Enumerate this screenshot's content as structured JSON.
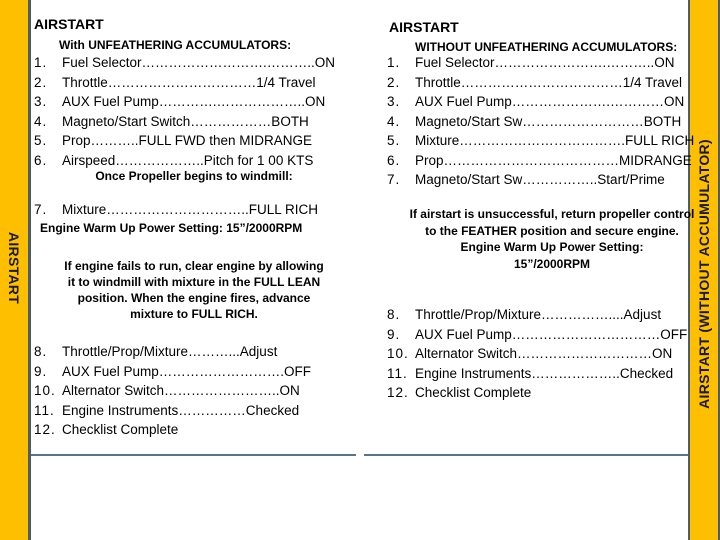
{
  "side_tabs": {
    "left": "AIRSTART",
    "right": "AIRSTART (WITHOUT ACCUMULATOR)"
  },
  "colors": {
    "tab_yellow": "#fdbf00",
    "border_slate": "#4a5e70",
    "rule": "#5b7387"
  },
  "left_panel": {
    "title": "AIRSTART",
    "subtitle": "With UNFEATHERING ACCUMULATORS:",
    "steps_part1": [
      {
        "num": "1.",
        "text": "Fuel Selector……………………….………..ON"
      },
      {
        "num": "2.",
        "text": "Throttle……………………………1/4 Travel"
      },
      {
        "num": "3.",
        "text": "AUX Fuel Pump………….………………..ON"
      },
      {
        "num": "4.",
        "text": "Magneto/Start Switch………………BOTH"
      },
      {
        "num": "5.",
        "text": "Prop………..FULL FWD then MIDRANGE"
      },
      {
        "num": "6.",
        "text": "Airspeed………………..Pitch for 1 00 KTS"
      }
    ],
    "windmill_note": "Once Propeller begins to windmill:",
    "step7": {
      "num": "7.",
      "text": "Mixture…………………………..FULL RICH"
    },
    "warmup_note": "Engine Warm Up Power Setting: 15”/2000RPM",
    "fail_note": "If engine fails to run, clear engine by allowing it to windmill with mixture in the FULL LEAN position. When the engine fires, advance mixture to FULL RICH.",
    "steps_part2": [
      {
        "num": "8.",
        "text": "Throttle/Prop/Mixture………...Adjust"
      },
      {
        "num": "9.",
        "text": "AUX Fuel Pump……………………….OFF"
      },
      {
        "num": "10.",
        "text": "Alternator Switch……………………..ON"
      },
      {
        "num": "11.",
        "text": "Engine Instruments……………Checked"
      },
      {
        "num": "12.",
        "text": "Checklist Complete"
      }
    ]
  },
  "right_panel": {
    "title": "AIRSTART",
    "subtitle": "WITHOUT UNFEATHERING ACCUMULATORS:",
    "steps_part1": [
      {
        "num": "1.",
        "text": "Fuel Selector…………………….………..ON"
      },
      {
        "num": "2.",
        "text": "Throttle………………………………1/4 Travel"
      },
      {
        "num": "3.",
        "text": "AUX Fuel Pump………………….…………ON"
      },
      {
        "num": "4.",
        "text": "Magneto/Start Sw………………………BOTH"
      },
      {
        "num": "5.",
        "text": "Mixture……………………………….FULL RICH"
      },
      {
        "num": "6.",
        "text": "Prop…………………………………MIDRANGE"
      },
      {
        "num": "7.",
        "text": "Magneto/Start Sw……………..Start/Prime"
      }
    ],
    "unsuccess_note": "If airstart is unsuccessful, return propeller control to the FEATHER position and secure engine.",
    "warmup_note_line1": "Engine Warm Up Power Setting:",
    "warmup_note_line2": "15”/2000RPM",
    "steps_part2": [
      {
        "num": "8.",
        "text": "Throttle/Prop/Mixture……………....Adjust"
      },
      {
        "num": "9.",
        "text": "AUX Fuel Pump……………………………OFF"
      },
      {
        "num": "10.",
        "text": "Alternator Switch…………………………ON"
      },
      {
        "num": "11.",
        "text": "Engine Instruments………………..Checked"
      },
      {
        "num": "12.",
        "text": "Checklist Complete"
      }
    ]
  }
}
